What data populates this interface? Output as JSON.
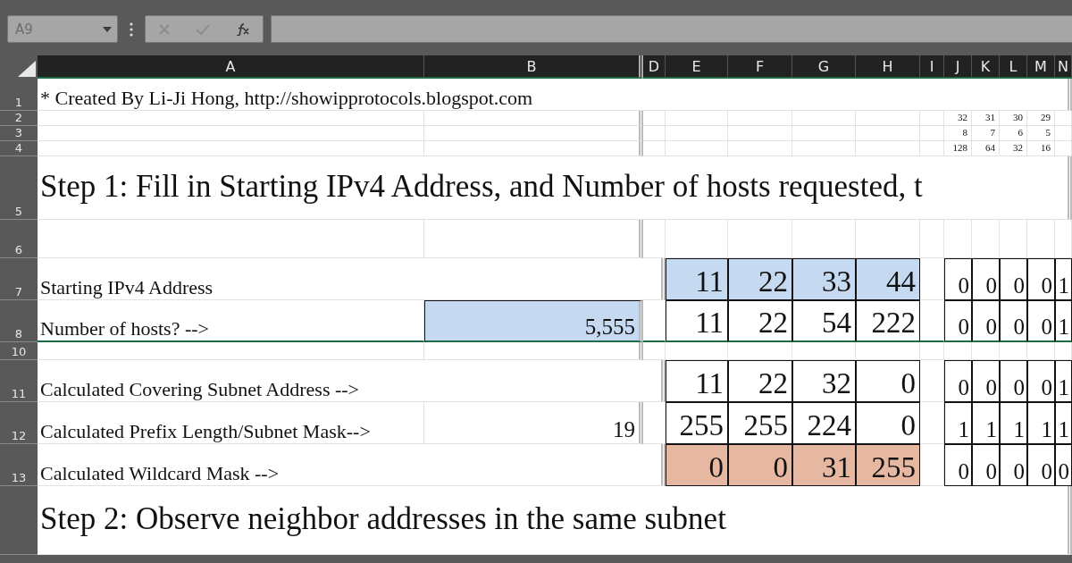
{
  "formula_bar": {
    "name_box": "A9"
  },
  "columns": [
    "A",
    "B",
    "D",
    "E",
    "F",
    "G",
    "H",
    "I",
    "J",
    "K",
    "L",
    "M",
    "N"
  ],
  "rows": [
    {
      "number": "1",
      "kind": "note",
      "label": "* Created By Li-Ji Hong, http://showipprotocols.blogspot.com"
    },
    {
      "number": "2",
      "kind": "small",
      "bits": [
        {
          "text": "32"
        },
        {
          "text": "31"
        },
        {
          "text": "30"
        },
        {
          "text": "29"
        }
      ]
    },
    {
      "number": "3",
      "kind": "small",
      "bits": [
        {
          "text": "8"
        },
        {
          "text": "7"
        },
        {
          "text": "6"
        },
        {
          "text": "5"
        }
      ]
    },
    {
      "number": "4",
      "kind": "small",
      "bits": [
        {
          "text": "128"
        },
        {
          "text": "64"
        },
        {
          "text": "32"
        },
        {
          "text": "16"
        }
      ]
    },
    {
      "number": "5",
      "kind": "heading",
      "label": "Step 1: Fill in Starting IPv4 Address, and Number of hosts requested, t"
    },
    {
      "number": "6",
      "kind": "spacer"
    },
    {
      "number": "7",
      "kind": "data",
      "label": "Starting IPv4 Address",
      "octets": [
        {
          "text": "11",
          "color": "#c5d9f1",
          "border": true
        },
        {
          "text": "22",
          "color": "#c5d9f1",
          "border": true
        },
        {
          "text": "33",
          "color": "#c5d9f1",
          "border": true
        },
        {
          "text": "44",
          "color": "#c5d9f1",
          "border": true
        }
      ],
      "bits": [
        {
          "text": "0",
          "border": true
        },
        {
          "text": "0",
          "border": true
        },
        {
          "text": "0",
          "border": true
        },
        {
          "text": "0",
          "border": true
        },
        {
          "text": "1",
          "border": true
        }
      ]
    },
    {
      "number": "8",
      "kind": "data",
      "label": "Number of hosts? -->",
      "input": {
        "text": "5,555",
        "color": "#c5d9f1",
        "border": true
      },
      "octets": [
        {
          "text": "11",
          "border": true
        },
        {
          "text": "22",
          "border": true
        },
        {
          "text": "54",
          "border": true
        },
        {
          "text": "222",
          "border": true
        }
      ],
      "bits": [
        {
          "text": "0",
          "border": true
        },
        {
          "text": "0",
          "border": true
        },
        {
          "text": "0",
          "border": true
        },
        {
          "text": "0",
          "border": true
        },
        {
          "text": "1",
          "border": true
        }
      ]
    },
    {
      "number": "10",
      "kind": "gap"
    },
    {
      "number": "11",
      "kind": "data",
      "label": "Calculated Covering Subnet Address -->",
      "octets": [
        {
          "text": "11",
          "border": true
        },
        {
          "text": "22",
          "border": true
        },
        {
          "text": "32",
          "border": true
        },
        {
          "text": "0",
          "border": true
        }
      ],
      "bits": [
        {
          "text": "0",
          "border": true
        },
        {
          "text": "0",
          "border": true
        },
        {
          "text": "0",
          "border": true
        },
        {
          "text": "0",
          "border": true
        },
        {
          "text": "1",
          "border": true
        }
      ]
    },
    {
      "number": "12",
      "kind": "data",
      "label": "Calculated Prefix Length/Subnet Mask-->",
      "input": {
        "text": "19"
      },
      "octets": [
        {
          "text": "255",
          "border": true
        },
        {
          "text": "255",
          "border": true
        },
        {
          "text": "224",
          "border": true
        },
        {
          "text": "0",
          "border": true
        }
      ],
      "bits": [
        {
          "text": "1",
          "border": true
        },
        {
          "text": "1",
          "border": true
        },
        {
          "text": "1",
          "border": true
        },
        {
          "text": "1",
          "border": true
        },
        {
          "text": "1",
          "border": true
        }
      ]
    },
    {
      "number": "13",
      "kind": "data",
      "label": "Calculated Wildcard Mask -->",
      "octets": [
        {
          "text": "0",
          "color": "#e6b8a2",
          "border": true
        },
        {
          "text": "0",
          "color": "#e6b8a2",
          "border": true
        },
        {
          "text": "31",
          "color": "#e6b8a2",
          "border": true
        },
        {
          "text": "255",
          "color": "#e6b8a2",
          "border": true
        }
      ],
      "bits": [
        {
          "text": "0",
          "border": true
        },
        {
          "text": "0",
          "border": true
        },
        {
          "text": "0",
          "border": true
        },
        {
          "text": "0",
          "border": true
        },
        {
          "text": "0",
          "border": true
        }
      ]
    },
    {
      "kind": "heading2",
      "label": "Step 2: Observe neighbor addresses in the same subnet"
    }
  ]
}
